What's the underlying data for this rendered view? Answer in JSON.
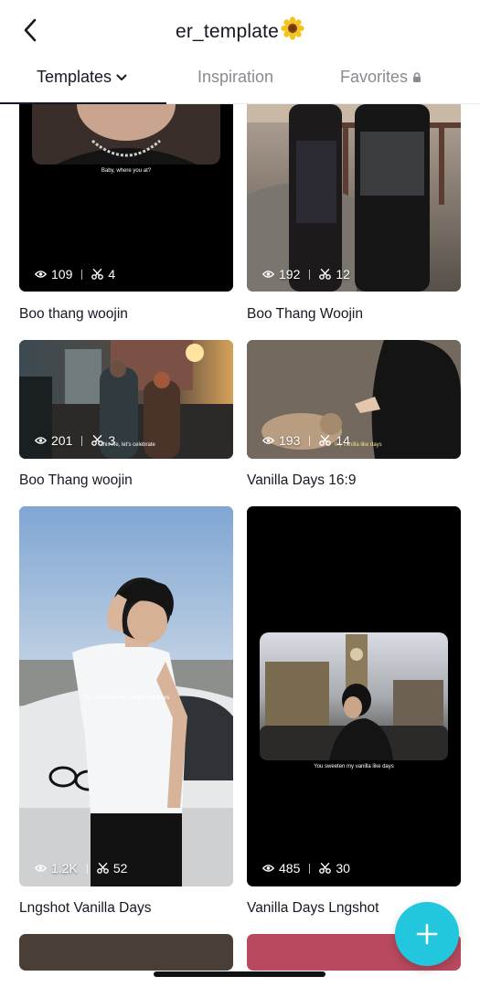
{
  "header": {
    "title": "er_template",
    "back_icon": "chevron-left-icon",
    "title_emoji_icon": "sunflower-icon"
  },
  "tabs": [
    {
      "label": "Templates",
      "active": true,
      "icon": "chevron-down-icon"
    },
    {
      "label": "Inspiration",
      "active": false
    },
    {
      "label": "Favorites",
      "active": false,
      "icon": "lock-icon"
    }
  ],
  "cards": [
    {
      "title": "Boo thang woojin",
      "views": "109",
      "uses": "4",
      "caption": "Baby, where you at?"
    },
    {
      "title": "Boo Thang Woojin",
      "views": "192",
      "uses": "12"
    },
    {
      "title": "Boo Thang woojin",
      "views": "201",
      "uses": "3",
      "caption": "this life, let's celebrate"
    },
    {
      "title": "Vanilla Days 16:9",
      "views": "193",
      "uses": "14",
      "caption": "my vanilla like days"
    },
    {
      "title": "Lngshot Vanilla Days",
      "views": "1.2K",
      "uses": "52",
      "caption": "You sweeten my vanilla like days"
    },
    {
      "title": "Vanilla Days Lngshot",
      "views": "485",
      "uses": "30",
      "caption": "You sweeten my vanilla like days"
    }
  ],
  "colors": {
    "accent_fab": "#22c6dd",
    "text_primary": "#161823",
    "text_secondary": "#8a8b91"
  },
  "fab": {
    "icon": "plus-icon"
  }
}
